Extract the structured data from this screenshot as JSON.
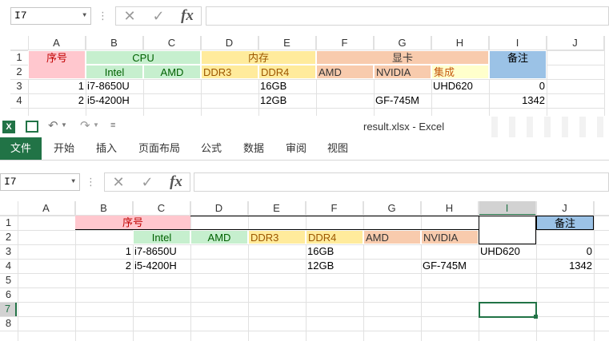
{
  "top": {
    "namebox": "I7",
    "fx": "fx",
    "cols": [
      "A",
      "B",
      "C",
      "D",
      "E",
      "F",
      "G",
      "H",
      "I",
      "J"
    ],
    "rows": [
      "1",
      "2",
      "3",
      "4"
    ],
    "h_seq": "序号",
    "h_cpu": "CPU",
    "h_mem": "内存",
    "h_gpu": "显卡",
    "h_note": "备注",
    "sub_intel": "Intel",
    "sub_amd": "AMD",
    "sub_ddr3": "DDR3",
    "sub_ddr4": "DDR4",
    "sub_amd2": "AMD",
    "sub_nvidia": "NVIDIA",
    "sub_integrated": "集成",
    "r3": {
      "seq": "1",
      "intel": "i7-8650U",
      "ddr4": "16GB",
      "integrated": "UHD620",
      "note": "0"
    },
    "r4": {
      "seq": "2",
      "intel": "i5-4200H",
      "ddr4": "12GB",
      "nvidia": "GF-745M",
      "note": "1342"
    }
  },
  "window": {
    "title": "result.xlsx - Excel",
    "tabs": [
      "文件",
      "开始",
      "插入",
      "页面布局",
      "公式",
      "数据",
      "审阅",
      "视图"
    ]
  },
  "bottom": {
    "namebox": "I7",
    "fx": "fx",
    "cols": [
      "A",
      "B",
      "C",
      "D",
      "E",
      "F",
      "G",
      "H",
      "I",
      "J"
    ],
    "rows": [
      "1",
      "2",
      "3",
      "4",
      "5",
      "6",
      "7",
      "8"
    ],
    "h_seq": "序号",
    "h_note": "备注",
    "sub_intel": "Intel",
    "sub_amd": "AMD",
    "sub_ddr3": "DDR3",
    "sub_ddr4": "DDR4",
    "sub_amd2": "AMD",
    "sub_nvidia": "NVIDIA",
    "r3": {
      "seq": "1",
      "intel": "i7-8650U",
      "ddr4": "16GB",
      "uhd": "UHD620",
      "note": "0"
    },
    "r4": {
      "seq": "2",
      "intel": "i5-4200H",
      "ddr4": "12GB",
      "nvidia": "GF-745M",
      "note": "1342"
    }
  },
  "colors": {
    "pink": "#ffc7ce",
    "green": "#c6efce",
    "yellow": "#ffeb9c",
    "orange": "#f8cbad",
    "lightyellow": "#ffffcc",
    "blue": "#9bc2e6",
    "excel_green": "#217346"
  }
}
